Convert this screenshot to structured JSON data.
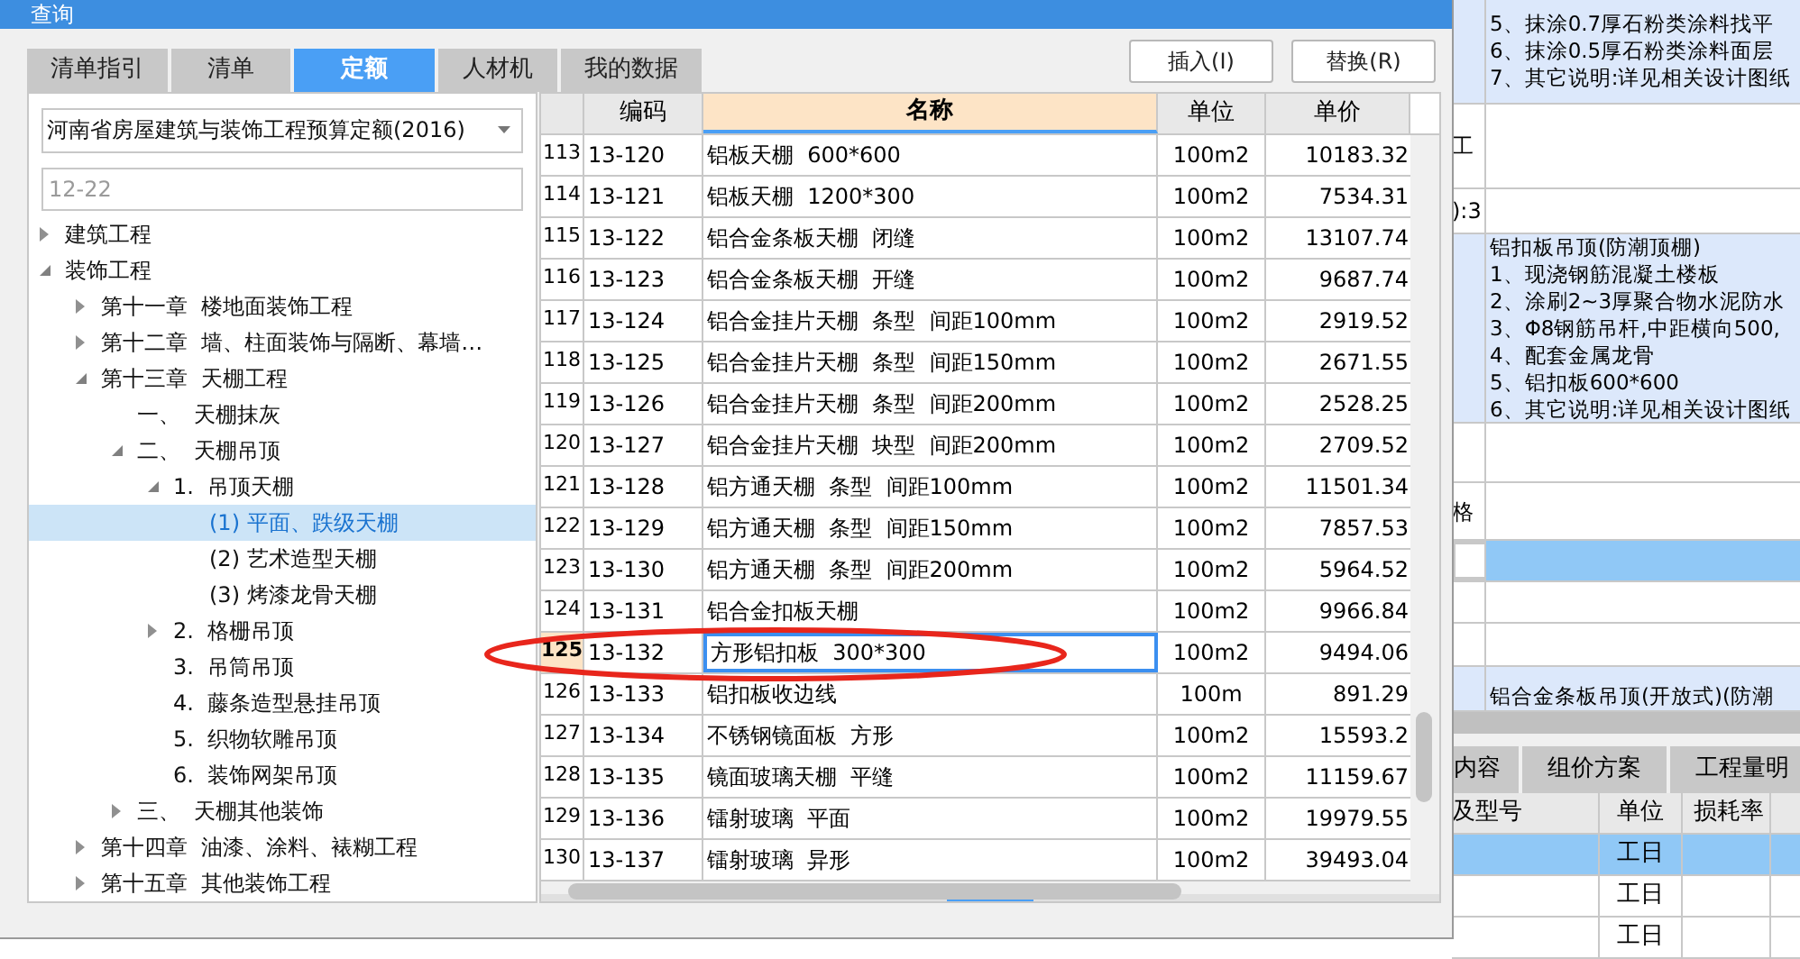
{
  "dialog": {
    "title": "查询",
    "tabs": [
      {
        "label": "清单指引",
        "selected": false
      },
      {
        "label": "清单",
        "selected": false
      },
      {
        "label": "定额",
        "selected": true
      },
      {
        "label": "人材机",
        "selected": false
      },
      {
        "label": "我的数据",
        "selected": false
      }
    ],
    "buttons": [
      "插入(I)",
      "替换(R)"
    ],
    "library_dropdown": {
      "value": "河南省房屋建筑与装饰工程预算定额(2016)"
    },
    "search": {
      "placeholder": "12-22"
    },
    "tree": [
      {
        "label": "建筑工程",
        "expanded": false,
        "selected": false
      },
      {
        "label": "装饰工程",
        "expanded": true,
        "selected": false,
        "children": [
          {
            "label": "第十一章  楼地面装饰工程",
            "expanded": false,
            "selected": false
          },
          {
            "label": "第十二章  墙、柱面装饰与隔断、幕墙…",
            "expanded": false,
            "selected": false
          },
          {
            "label": "第十三章  天棚工程",
            "expanded": true,
            "selected": false,
            "children": [
              {
                "label": "一、  天棚抹灰",
                "selected": false
              },
              {
                "label": "二、  天棚吊顶",
                "expanded": true,
                "selected": false,
                "children": [
                  {
                    "label": "1.  吊顶天棚",
                    "expanded": true,
                    "selected": false,
                    "children": [
                      {
                        "label": "(1) 平面、跌级天棚",
                        "selected": true
                      },
                      {
                        "label": "(2) 艺术造型天棚",
                        "selected": false
                      },
                      {
                        "label": "(3) 烤漆龙骨天棚",
                        "selected": false
                      }
                    ]
                  },
                  {
                    "label": "2.  格栅吊顶",
                    "expanded": false,
                    "selected": false
                  },
                  {
                    "label": "3.  吊筒吊顶",
                    "selected": false
                  },
                  {
                    "label": "4.  藤条造型悬挂吊顶",
                    "selected": false
                  },
                  {
                    "label": "5.  织物软雕吊顶",
                    "selected": false
                  },
                  {
                    "label": "6.  装饰网架吊顶",
                    "selected": false
                  }
                ]
              },
              {
                "label": "三、  天棚其他装饰",
                "expanded": false,
                "selected": false
              }
            ]
          },
          {
            "label": "第十四章  油漆、涂料、裱糊工程",
            "expanded": false,
            "selected": false
          },
          {
            "label": "第十五章  其他装饰工程",
            "expanded": false,
            "selected": false
          }
        ]
      }
    ],
    "table": {
      "columns": [
        {
          "label": "编码",
          "active": false
        },
        {
          "label": "名称",
          "active": true
        },
        {
          "label": "单位",
          "active": false
        },
        {
          "label": "单价",
          "active": false
        }
      ],
      "rows": [
        {
          "index": "113",
          "code": "13-120",
          "name": "铝板天棚  600*600",
          "unit": "100m2",
          "price": "10183.32",
          "selected": false
        },
        {
          "index": "114",
          "code": "13-121",
          "name": "铝板天棚  1200*300",
          "unit": "100m2",
          "price": "7534.31",
          "selected": false
        },
        {
          "index": "115",
          "code": "13-122",
          "name": "铝合金条板天棚  闭缝",
          "unit": "100m2",
          "price": "13107.74",
          "selected": false
        },
        {
          "index": "116",
          "code": "13-123",
          "name": "铝合金条板天棚  开缝",
          "unit": "100m2",
          "price": "9687.74",
          "selected": false
        },
        {
          "index": "117",
          "code": "13-124",
          "name": "铝合金挂片天棚  条型  间距100mm",
          "unit": "100m2",
          "price": "2919.52",
          "selected": false
        },
        {
          "index": "118",
          "code": "13-125",
          "name": "铝合金挂片天棚  条型  间距150mm",
          "unit": "100m2",
          "price": "2671.55",
          "selected": false
        },
        {
          "index": "119",
          "code": "13-126",
          "name": "铝合金挂片天棚  条型  间距200mm",
          "unit": "100m2",
          "price": "2528.25",
          "selected": false
        },
        {
          "index": "120",
          "code": "13-127",
          "name": "铝合金挂片天棚  块型  间距200mm",
          "unit": "100m2",
          "price": "2709.52",
          "selected": false
        },
        {
          "index": "121",
          "code": "13-128",
          "name": "铝方通天棚  条型  间距100mm",
          "unit": "100m2",
          "price": "11501.34",
          "selected": false
        },
        {
          "index": "122",
          "code": "13-129",
          "name": "铝方通天棚  条型  间距150mm",
          "unit": "100m2",
          "price": "7857.53",
          "selected": false
        },
        {
          "index": "123",
          "code": "13-130",
          "name": "铝方通天棚  条型  间距200mm",
          "unit": "100m2",
          "price": "5964.52",
          "selected": false
        },
        {
          "index": "124",
          "code": "13-131",
          "name": "铝合金扣板天棚",
          "unit": "100m2",
          "price": "9966.84",
          "selected": false
        },
        {
          "index": "125",
          "code": "13-132",
          "name": "方形铝扣板  300*300",
          "unit": "100m2",
          "price": "9494.06",
          "selected": true
        },
        {
          "index": "126",
          "code": "13-133",
          "name": "铝扣板收边线",
          "unit": "100m",
          "price": "891.29",
          "selected": false
        },
        {
          "index": "127",
          "code": "13-134",
          "name": "不锈钢镜面板  方形",
          "unit": "100m2",
          "price": "15593.2",
          "selected": false
        },
        {
          "index": "128",
          "code": "13-135",
          "name": "镜面玻璃天棚  平缝",
          "unit": "100m2",
          "price": "11159.67",
          "selected": false
        },
        {
          "index": "129",
          "code": "13-136",
          "name": "镭射玻璃  平面",
          "unit": "100m2",
          "price": "19979.55",
          "selected": false
        },
        {
          "index": "130",
          "code": "13-137",
          "name": "镭射玻璃  异形",
          "unit": "100m2",
          "price": "39493.04",
          "selected": false
        }
      ]
    }
  },
  "background_window": {
    "upper_rows": [
      {
        "kind": "description",
        "selected": false,
        "lines": [
          "5、抹涂0.7厚石粉类涂料找平",
          "6、抹涂0.5厚石粉类涂料面层",
          "7、其它说明:详见相关设计图纸"
        ]
      },
      {
        "kind": "plain",
        "selected": false,
        "label": "工"
      },
      {
        "kind": "plain",
        "selected": false,
        "label": "):3"
      },
      {
        "kind": "description",
        "selected": false,
        "lines": [
          "铝扣板吊顶(防潮顶棚)",
          "1、现浇钢筋混凝土楼板",
          "2、涂刷2~3厚聚合物水泥防水",
          "3、Φ8钢筋吊杆,中距横向500,",
          "4、配套金属龙骨",
          "5、铝扣板600*600",
          "6、其它说明:详见相关设计图纸"
        ]
      },
      {
        "kind": "plain",
        "selected": false
      },
      {
        "kind": "plain",
        "selected": false,
        "label": "格"
      },
      {
        "kind": "plain",
        "selected": true
      },
      {
        "kind": "plain",
        "selected": false
      },
      {
        "kind": "plain",
        "selected": false
      },
      {
        "kind": "description",
        "selected": false,
        "lines": [
          "铝合金条板吊顶(开放式)(防潮"
        ]
      }
    ],
    "tabs": [
      {
        "label": "内容",
        "selected": false
      },
      {
        "label": "组价方案",
        "selected": false
      },
      {
        "label": "工程量明",
        "selected": false
      }
    ],
    "columns": [
      "及型号",
      "单位",
      "损耗率"
    ],
    "rows": [
      {
        "unit": "工日",
        "selected": true
      },
      {
        "unit": "工日",
        "selected": false
      },
      {
        "unit": "工日",
        "selected": false
      }
    ]
  }
}
